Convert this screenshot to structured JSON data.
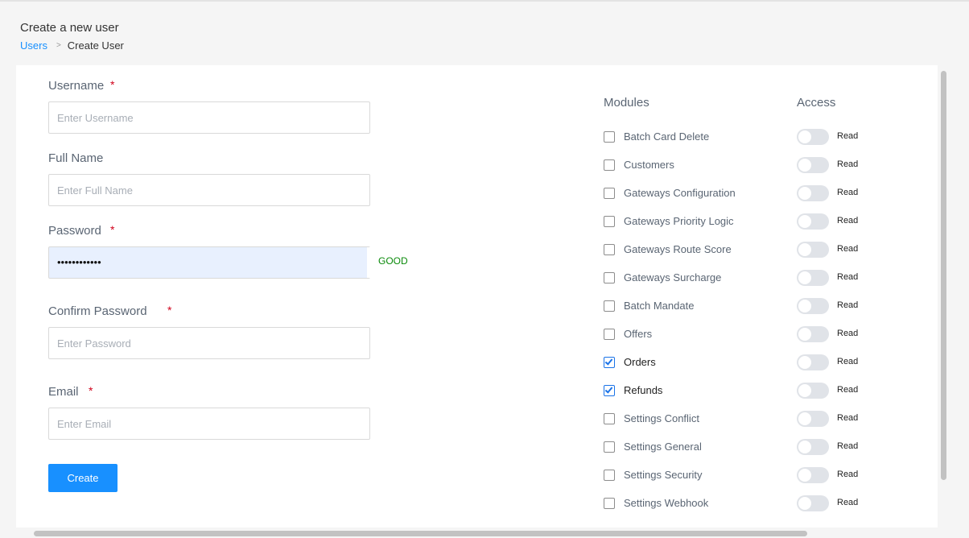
{
  "header": {
    "title": "Create a new user",
    "breadcrumb": {
      "link": "Users",
      "separator": ">",
      "current": "Create User"
    }
  },
  "form": {
    "username": {
      "label": "Username",
      "required_mark": "*",
      "placeholder": "Enter Username",
      "value": ""
    },
    "full_name": {
      "label": "Full Name",
      "placeholder": "Enter Full Name",
      "value": ""
    },
    "password": {
      "label": "Password",
      "required_mark": "*",
      "value": "••••••••••••",
      "strength": "GOOD"
    },
    "confirm_password": {
      "label": "Confirm Password",
      "required_mark": "*",
      "placeholder": "Enter Password",
      "value": ""
    },
    "email": {
      "label": "Email",
      "required_mark": "*",
      "placeholder": "Enter Email",
      "value": ""
    },
    "submit_label": "Create"
  },
  "permissions": {
    "modules_header": "Modules",
    "access_header": "Access",
    "modules": [
      {
        "name": "Batch Card Delete",
        "checked": false,
        "access": "Read",
        "access_on": false
      },
      {
        "name": "Customers",
        "checked": false,
        "access": "Read",
        "access_on": false
      },
      {
        "name": "Gateways Configuration",
        "checked": false,
        "access": "Read",
        "access_on": false
      },
      {
        "name": "Gateways Priority Logic",
        "checked": false,
        "access": "Read",
        "access_on": false
      },
      {
        "name": "Gateways Route Score",
        "checked": false,
        "access": "Read",
        "access_on": false
      },
      {
        "name": "Gateways Surcharge",
        "checked": false,
        "access": "Read",
        "access_on": false
      },
      {
        "name": "Batch Mandate",
        "checked": false,
        "access": "Read",
        "access_on": false
      },
      {
        "name": "Offers",
        "checked": false,
        "access": "Read",
        "access_on": false
      },
      {
        "name": "Orders",
        "checked": true,
        "access": "Read",
        "access_on": false
      },
      {
        "name": "Refunds",
        "checked": true,
        "access": "Read",
        "access_on": false
      },
      {
        "name": "Settings Conflict",
        "checked": false,
        "access": "Read",
        "access_on": false
      },
      {
        "name": "Settings General",
        "checked": false,
        "access": "Read",
        "access_on": false
      },
      {
        "name": "Settings Security",
        "checked": false,
        "access": "Read",
        "access_on": false
      },
      {
        "name": "Settings Webhook",
        "checked": false,
        "access": "Read",
        "access_on": false
      }
    ]
  },
  "colors": {
    "primary": "#1890ff",
    "required": "#d0021b",
    "strength_good": "#0a8a0a",
    "autofill_bg": "#e8f0fe",
    "checkbox_checked": "#1a73e8"
  }
}
